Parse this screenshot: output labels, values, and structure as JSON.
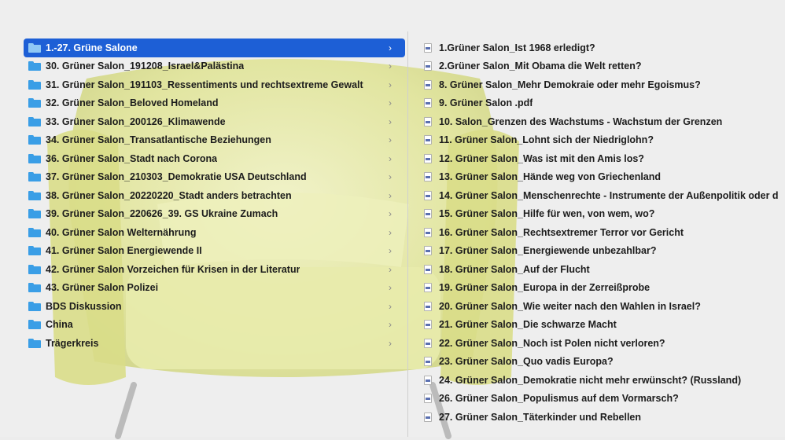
{
  "folders": [
    {
      "label": "1.-27. Grüne Salone",
      "selected": true
    },
    {
      "label": "30. Grüner Salon_191208_Israel&Palästina"
    },
    {
      "label": "31. Grüner Salon_191103_Ressentiments und rechtsextreme Gewalt"
    },
    {
      "label": "32. Grüner Salon_Beloved Homeland"
    },
    {
      "label": "33. Grüner Salon_200126_Klimawende"
    },
    {
      "label": "34. Grüner Salon_Transatlantische Beziehungen"
    },
    {
      "label": "36. Grüner Salon_Stadt nach Corona"
    },
    {
      "label": "37. Grüner Salon_210303_Demokratie USA Deutschland"
    },
    {
      "label": "38. Grüner Salon_20220220_Stadt anders betrachten"
    },
    {
      "label": "39. Grüner Salon_220626_39. GS Ukraine Zumach"
    },
    {
      "label": "40. Grüner Salon Welternährung"
    },
    {
      "label": "41. Grüner Salon Energiewende II"
    },
    {
      "label": "42. Grüner Salon Vorzeichen für Krisen in der Literatur"
    },
    {
      "label": "43. Grüner Salon Polizei"
    },
    {
      "label": "BDS Diskussion"
    },
    {
      "label": "China"
    },
    {
      "label": "Trägerkreis"
    }
  ],
  "chevron": "›",
  "files": [
    {
      "label": "1.Grüner Salon_Ist 1968 erledigt?"
    },
    {
      "label": "2.Grüner Salon_Mit Obama die Welt retten?"
    },
    {
      "label": "8. Grüner Salon_Mehr Demokraie oder mehr Egoismus?"
    },
    {
      "label": "9. Grüner Salon .pdf"
    },
    {
      "label": "10.  Salon_Grenzen des Wachstums - Wachstum der Grenzen"
    },
    {
      "label": "11. Grüner Salon_Lohnt sich der Niedriglohn?"
    },
    {
      "label": "12. Grüner Salon_Was ist mit den Amis los?"
    },
    {
      "label": "13. Grüner Salon_Hände weg von Griechenland"
    },
    {
      "label": "14. Grüner Salon_Menschenrechte - Instrumente der Außenpolitik oder d"
    },
    {
      "label": "15. Grüner Salon_Hilfe für wen, von wem, wo?"
    },
    {
      "label": "16. Grüner Salon_Rechtsextremer Terror vor Gericht"
    },
    {
      "label": "17. Grüner Salon_Energiewende unbezahlbar?"
    },
    {
      "label": "18. Grüner Salon_Auf der Flucht"
    },
    {
      "label": "19. Grüner Salon_Europa in der Zerreißprobe"
    },
    {
      "label": "20. Grüner Salon_Wie weiter nach den Wahlen in Israel?"
    },
    {
      "label": "21. Grüner Salon_Die schwarze Macht"
    },
    {
      "label": "22. Grüner Salon_Noch ist Polen nicht verloren?"
    },
    {
      "label": "23. Grüner Salon_Quo vadis Europa?"
    },
    {
      "label": "24. Grüner Salon_Demokratie nicht mehr erwünscht? (Russland)"
    },
    {
      "label": "26. Grüner Salon_Populismus auf dem Vormarsch?"
    },
    {
      "label": "27. Grüner Salon_Täterkinder und Rebellen"
    }
  ],
  "colors": {
    "selection": "#1d5fd6",
    "folder": "#3a9ee6",
    "chair": "#e4e89a"
  }
}
